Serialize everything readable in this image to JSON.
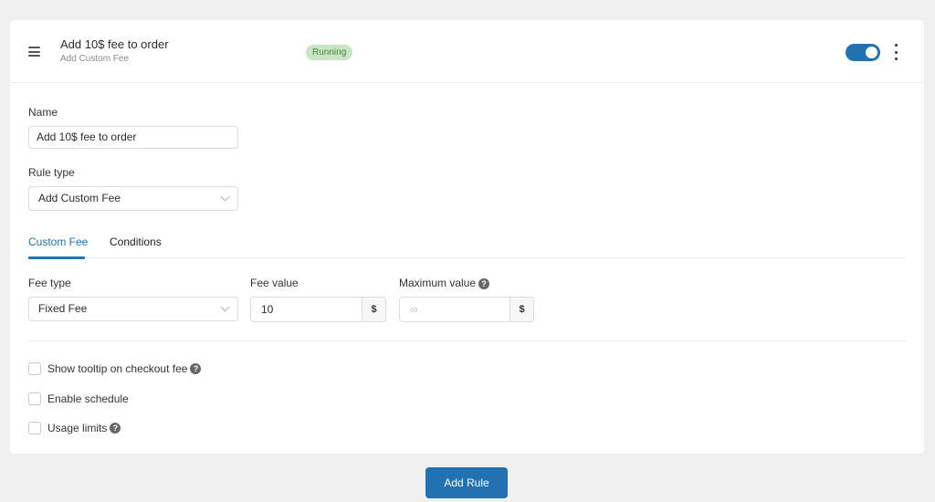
{
  "header": {
    "title": "Add 10$ fee to order",
    "subtitle": "Add Custom Fee",
    "status_badge": "Running",
    "enabled": true
  },
  "form": {
    "name_label": "Name",
    "name_value": "Add 10$ fee to order",
    "rule_type_label": "Rule type",
    "rule_type_value": "Add Custom Fee"
  },
  "tabs": [
    {
      "label": "Custom Fee",
      "active": true
    },
    {
      "label": "Conditions",
      "active": false
    }
  ],
  "custom_fee": {
    "fee_type_label": "Fee type",
    "fee_type_value": "Fixed Fee",
    "fee_value_label": "Fee value",
    "fee_value": "10",
    "fee_value_suffix": "$",
    "max_value_label": "Maximum value",
    "max_value_placeholder": "∞",
    "max_value_suffix": "$",
    "help_glyph": "?"
  },
  "options": [
    {
      "label": "Show tooltip on checkout fee",
      "checked": false,
      "help": true
    },
    {
      "label": "Enable schedule",
      "checked": false,
      "help": false
    },
    {
      "label": "Usage limits",
      "checked": false,
      "help": true
    }
  ],
  "footer": {
    "add_rule_label": "Add Rule"
  },
  "colors": {
    "accent": "#2271b1",
    "badge_bg": "#c8e6c3",
    "badge_text": "#4e7d45",
    "page_bg": "#f0f0f1"
  }
}
